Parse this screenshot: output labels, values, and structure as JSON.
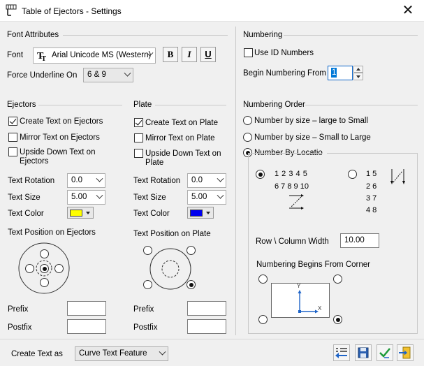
{
  "window": {
    "title": "Table of Ejectors - Settings"
  },
  "font_attributes": {
    "header": "Font Attributes",
    "font_label": "Font",
    "font_value": "Arial Unicode MS (Western)",
    "bold": "B",
    "italic": "I",
    "underline": "U",
    "force_underline_label": "Force Underline On",
    "force_underline_value": "6 & 9"
  },
  "ejectors": {
    "header": "Ejectors",
    "create_text": "Create Text on Ejectors",
    "mirror_text": "Mirror Text on Ejectors",
    "upside_down_line1": "Upside Down Text on",
    "upside_down_line2": "Ejectors",
    "rotation_label": "Text Rotation",
    "rotation_value": "0.0",
    "size_label": "Text Size",
    "size_value": "5.00",
    "color_label": "Text Color",
    "color": "#ffff00",
    "position_label": "Text Position on Ejectors",
    "prefix_label": "Prefix",
    "prefix_value": "",
    "postfix_label": "Postfix",
    "postfix_value": ""
  },
  "plate": {
    "header": "Plate",
    "create_text": "Create Text on Plate",
    "mirror_text": "Mirror Text on Plate",
    "upside_down_line1": "Upside Down Text on",
    "upside_down_line2": "Plate",
    "rotation_label": "Text Rotation",
    "rotation_value": "0.0",
    "size_label": "Text Size",
    "size_value": "5.00",
    "color_label": "Text Color",
    "color": "#0000ee",
    "position_label": "Text Position on Plate",
    "prefix_label": "Prefix",
    "prefix_value": "",
    "postfix_label": "Postfix",
    "postfix_value": ""
  },
  "numbering": {
    "header": "Numbering",
    "use_id": "Use ID Numbers",
    "begin_label": "Begin Numbering From",
    "begin_value": "1"
  },
  "numbering_order": {
    "header": "Numbering Order",
    "large_to_small": "Number by size – large to Small",
    "small_to_large": "Number by size – Small to Large",
    "by_location": "Number By Location",
    "row_seq_1": "1 2 3 4 5",
    "row_seq_2": "6 7 8 9 10",
    "col_seq_1": "1 5",
    "col_seq_2": "2 6",
    "col_seq_3": "3 7",
    "col_seq_4": "4 8",
    "row_col_label": "Row \\ Column Width",
    "row_col_value": "10.00",
    "corner_label": "Numbering Begins From Corner",
    "axis_x": "X",
    "axis_y": "Y"
  },
  "footer": {
    "create_as_label": "Create Text as",
    "create_as_value": "Curve Text Feature"
  }
}
